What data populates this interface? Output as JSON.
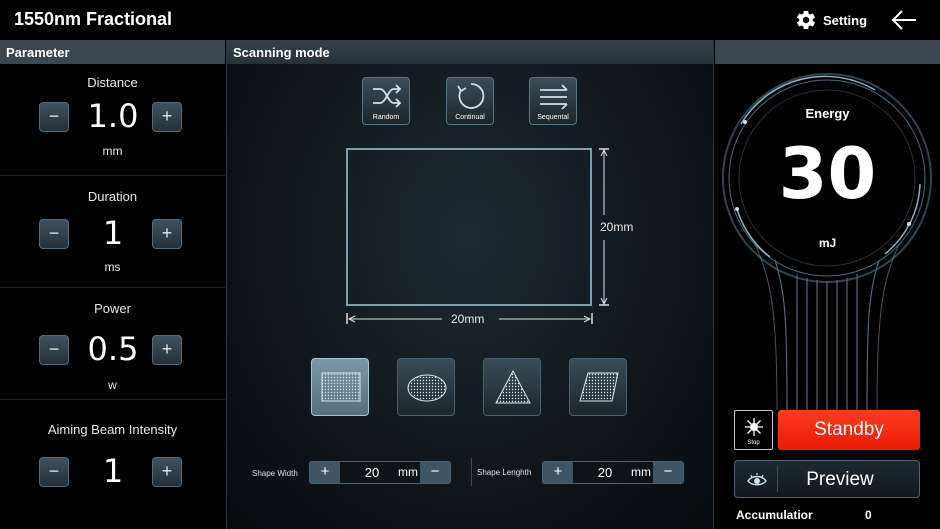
{
  "app": {
    "title": "1550nm Fractional",
    "setting_label": "Setting"
  },
  "parameters": {
    "header": "Parameter",
    "items": [
      {
        "name": "Distance",
        "value": "1.0",
        "unit": "mm"
      },
      {
        "name": "Duration",
        "value": "1",
        "unit": "ms"
      },
      {
        "name": "Power",
        "value": "0.5",
        "unit": "w"
      },
      {
        "name": "Aiming Beam Intensity",
        "value": "1",
        "unit": ""
      }
    ],
    "minus": "−",
    "plus": "+"
  },
  "scanning": {
    "header": "Scanning mode",
    "modes": [
      {
        "label": "Random",
        "icon": "shuffle-icon"
      },
      {
        "label": "Continual",
        "icon": "loop-icon"
      },
      {
        "label": "Sequental",
        "icon": "sequential-arrows-icon"
      }
    ],
    "dim_vertical": "20mm",
    "dim_horizontal": "20mm",
    "shapes": [
      {
        "icon": "rectangle-shape-icon",
        "active": true
      },
      {
        "icon": "ellipse-shape-icon",
        "active": false
      },
      {
        "icon": "triangle-shape-icon",
        "active": false
      },
      {
        "icon": "parallelogram-shape-icon",
        "active": false
      }
    ],
    "shape_width": {
      "label": "Shape Width",
      "value": "20",
      "unit": "mm"
    },
    "shape_length": {
      "label": "Shape Lenghth",
      "value": "20",
      "unit": "mm"
    }
  },
  "energy": {
    "label": "Energy",
    "value": "30",
    "unit": "mJ",
    "stop_label": "Stop",
    "standby_label": "Standby",
    "preview_label": "Preview",
    "accumulation_label": "Accumulatior",
    "accumulation_value": "0"
  },
  "colors": {
    "accent": "#7d9fae",
    "standby": "#f42a10",
    "panel_header": "#3a4650"
  }
}
